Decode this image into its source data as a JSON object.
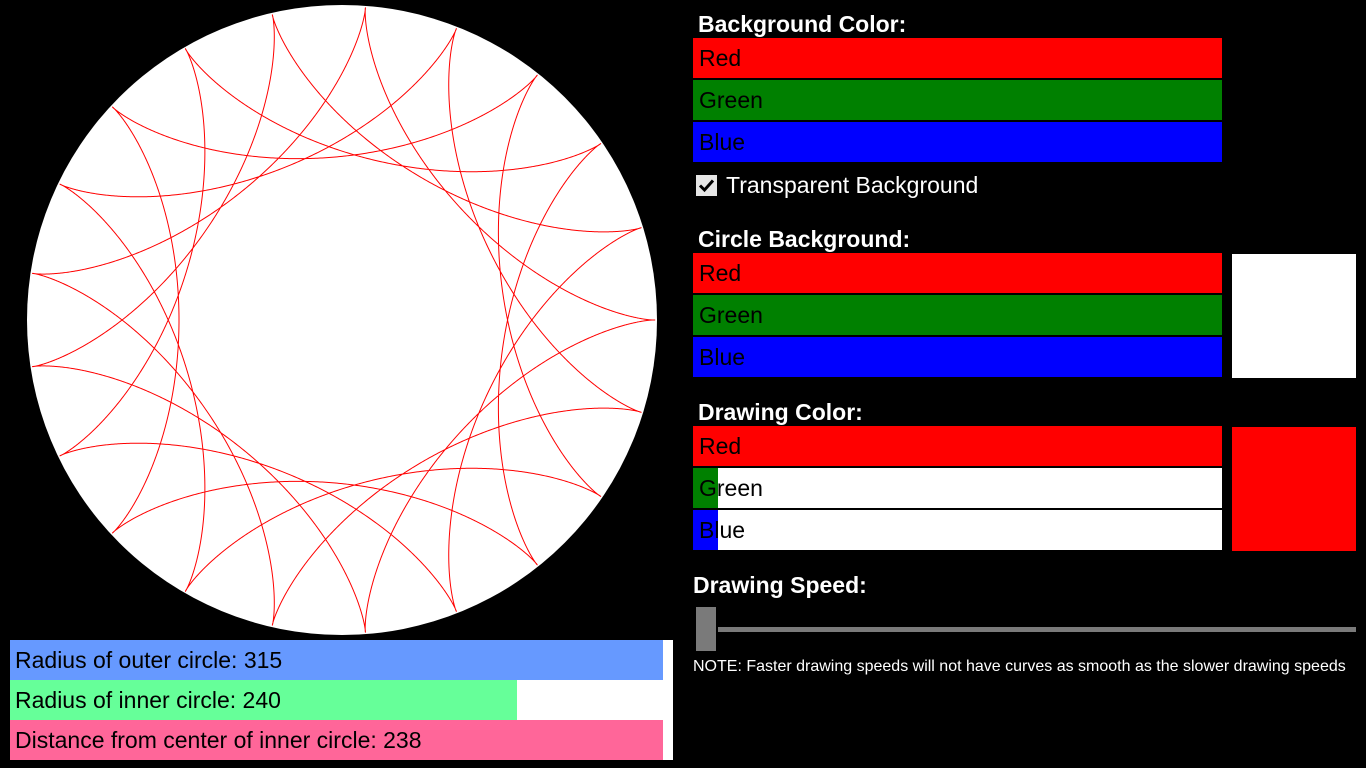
{
  "spirograph": {
    "outer_radius": 315,
    "inner_radius": 240,
    "pen_distance": 238,
    "circle_background": "#ffffff",
    "stroke_color": "#ff0000"
  },
  "bottom_controls": {
    "outer": {
      "label": "Radius of outer circle: 315",
      "color": "#6699ff",
      "fill": 0.985
    },
    "inner": {
      "label": "Radius of inner circle: 240",
      "color": "#66ff99",
      "fill": 0.765
    },
    "distance": {
      "label": "Distance from center of inner circle: 238",
      "color": "#ff6699",
      "fill": 0.985
    }
  },
  "background_color": {
    "heading": "Background Color:",
    "red": {
      "label": "Red",
      "color": "#ff0000",
      "fill": 1.0
    },
    "green": {
      "label": "Green",
      "color": "#008000",
      "fill": 1.0
    },
    "blue": {
      "label": "Blue",
      "color": "#0000ff",
      "fill": 1.0
    },
    "transparent_label": "Transparent Background",
    "transparent_checked": true
  },
  "circle_background": {
    "heading": "Circle Background:",
    "red": {
      "label": "Red",
      "color": "#ff0000",
      "fill": 1.0
    },
    "green": {
      "label": "Green",
      "color": "#008000",
      "fill": 1.0
    },
    "blue": {
      "label": "Blue",
      "color": "#0000ff",
      "fill": 1.0
    },
    "preview_color": "#ffffff"
  },
  "drawing_color": {
    "heading": "Drawing Color:",
    "red": {
      "label": "Red",
      "color": "#ff0000",
      "fill": 1.0
    },
    "green": {
      "label": "Green",
      "color": "#008000",
      "fill": 0.047
    },
    "blue": {
      "label": "Blue",
      "color": "#0000ff",
      "fill": 0.047
    },
    "preview_color": "#ff0000"
  },
  "drawing_speed": {
    "heading": "Drawing Speed:",
    "value_fraction": 0.0,
    "note": "NOTE: Faster drawing speeds will not have curves as smooth as the slower drawing speeds"
  }
}
